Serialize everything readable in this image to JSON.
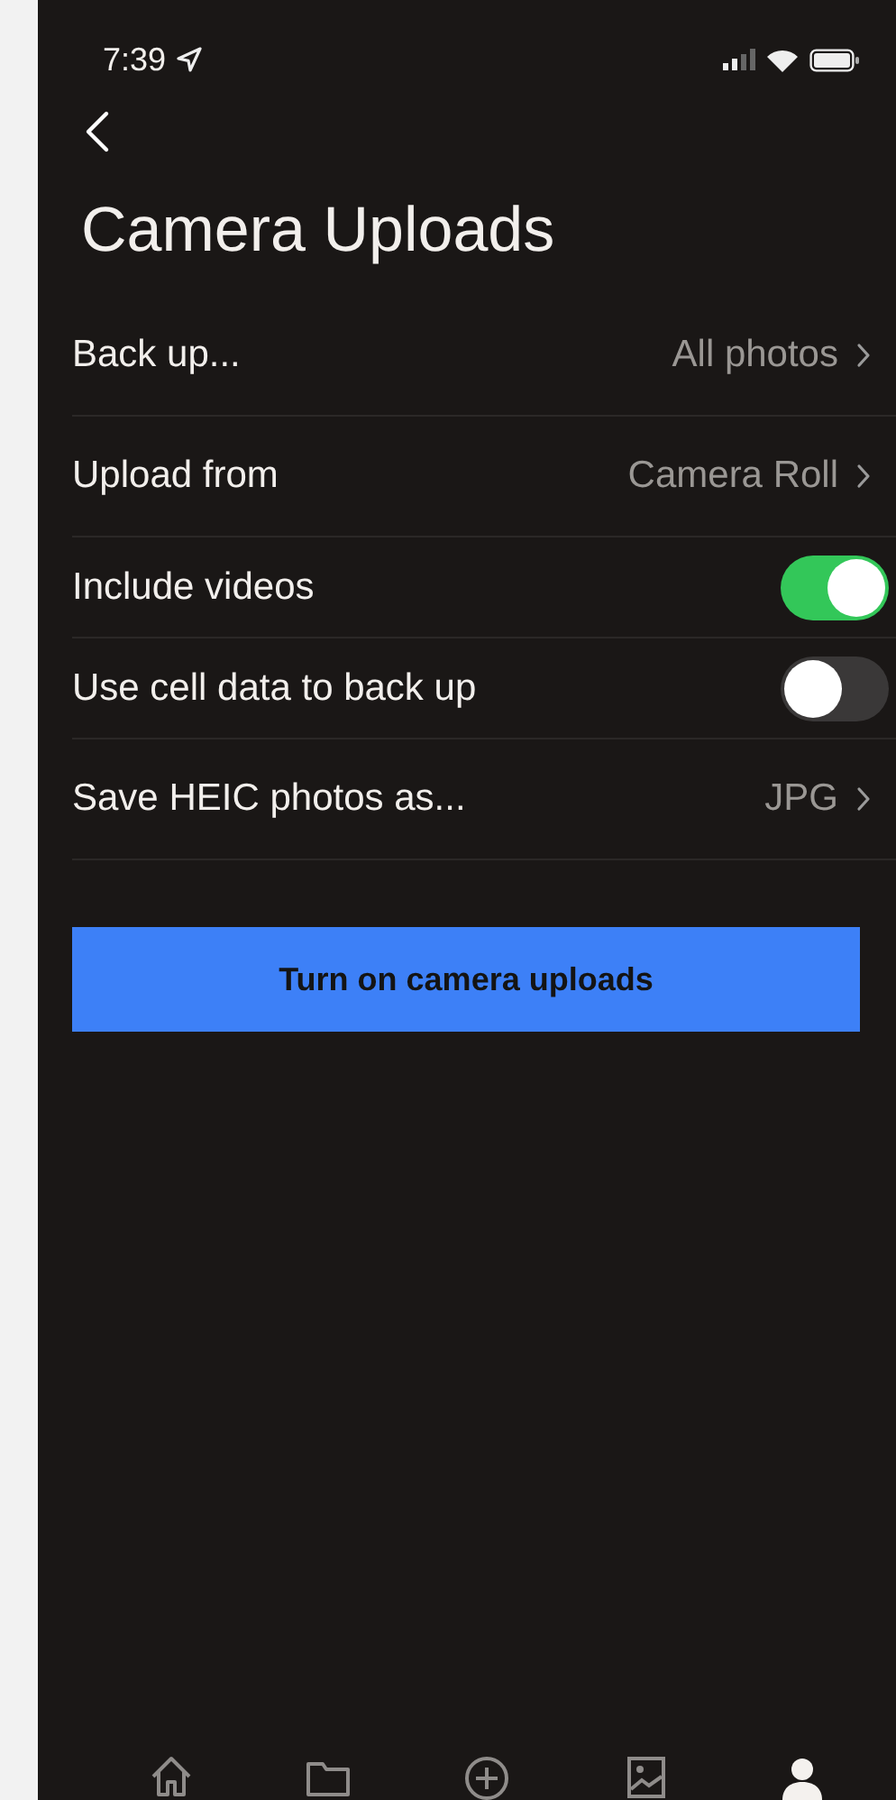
{
  "status_bar": {
    "time": "7:39"
  },
  "title": "Camera Uploads",
  "settings": [
    {
      "kind": "link",
      "label": "Back up...",
      "value": "All photos"
    },
    {
      "kind": "link",
      "label": "Upload from",
      "value": "Camera Roll"
    },
    {
      "kind": "toggle",
      "label": "Include videos",
      "on": true
    },
    {
      "kind": "toggle",
      "label": "Use cell data to back up",
      "on": false
    },
    {
      "kind": "link",
      "label": "Save HEIC photos as...",
      "value": "JPG"
    }
  ],
  "primary_button": "Turn on camera uploads",
  "tab_bar": [
    {
      "kind": "home",
      "selected": false
    },
    {
      "kind": "files",
      "selected": false
    },
    {
      "kind": "add",
      "selected": false
    },
    {
      "kind": "photos",
      "selected": false
    },
    {
      "kind": "account",
      "selected": true
    }
  ]
}
